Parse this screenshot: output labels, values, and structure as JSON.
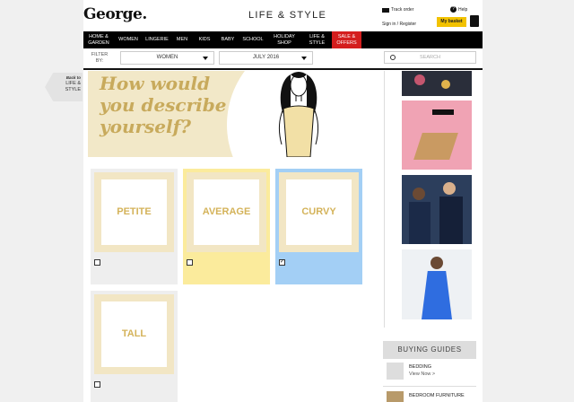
{
  "header": {
    "logo": "George.",
    "section_title": "LIFE & STYLE",
    "track_order": "Track order",
    "help": "Help",
    "signin": "Sign in / Register",
    "basket": "My basket"
  },
  "nav": {
    "items": [
      {
        "label": "HOME & GARDEN"
      },
      {
        "label": "WOMEN"
      },
      {
        "label": "LINGERIE"
      },
      {
        "label": "MEN"
      },
      {
        "label": "KIDS"
      },
      {
        "label": "BABY"
      },
      {
        "label": "SCHOOL"
      },
      {
        "label": "HOLIDAY SHOP"
      },
      {
        "label": "LIFE & STYLE"
      },
      {
        "label": "SALE & OFFERS"
      }
    ]
  },
  "filter": {
    "label": "FILTER BY:",
    "category_value": "WOMEN",
    "date_value": "JULY 2016",
    "search_placeholder": "SEARCH"
  },
  "back_link": {
    "small": "Back to",
    "label": "LIFE & STYLE"
  },
  "hero": {
    "title_line1": "How would",
    "title_line2": "you describe",
    "title_line3": "yourself?"
  },
  "options": [
    {
      "label": "PETITE",
      "checked": false,
      "bg": "#eeeeee"
    },
    {
      "label": "AVERAGE",
      "checked": false,
      "bg": "#fbeb9c"
    },
    {
      "label": "CURVY",
      "checked": true,
      "bg": "#a3cff5"
    },
    {
      "label": "TALL",
      "checked": false,
      "bg": "#eeeeee"
    }
  ],
  "buying_guides": {
    "heading": "BUYING GUIDES",
    "items": [
      {
        "title": "BEDDING",
        "link": "View Now >"
      },
      {
        "title": "BEDROOM FURNITURE",
        "link": ""
      }
    ]
  },
  "colors": {
    "nav_bg": "#000000",
    "sale_bg": "#d41e1e",
    "basket_bg": "#f2c200",
    "hero_bg": "#f2e8c8",
    "accent_gold": "#c8aa5c"
  }
}
